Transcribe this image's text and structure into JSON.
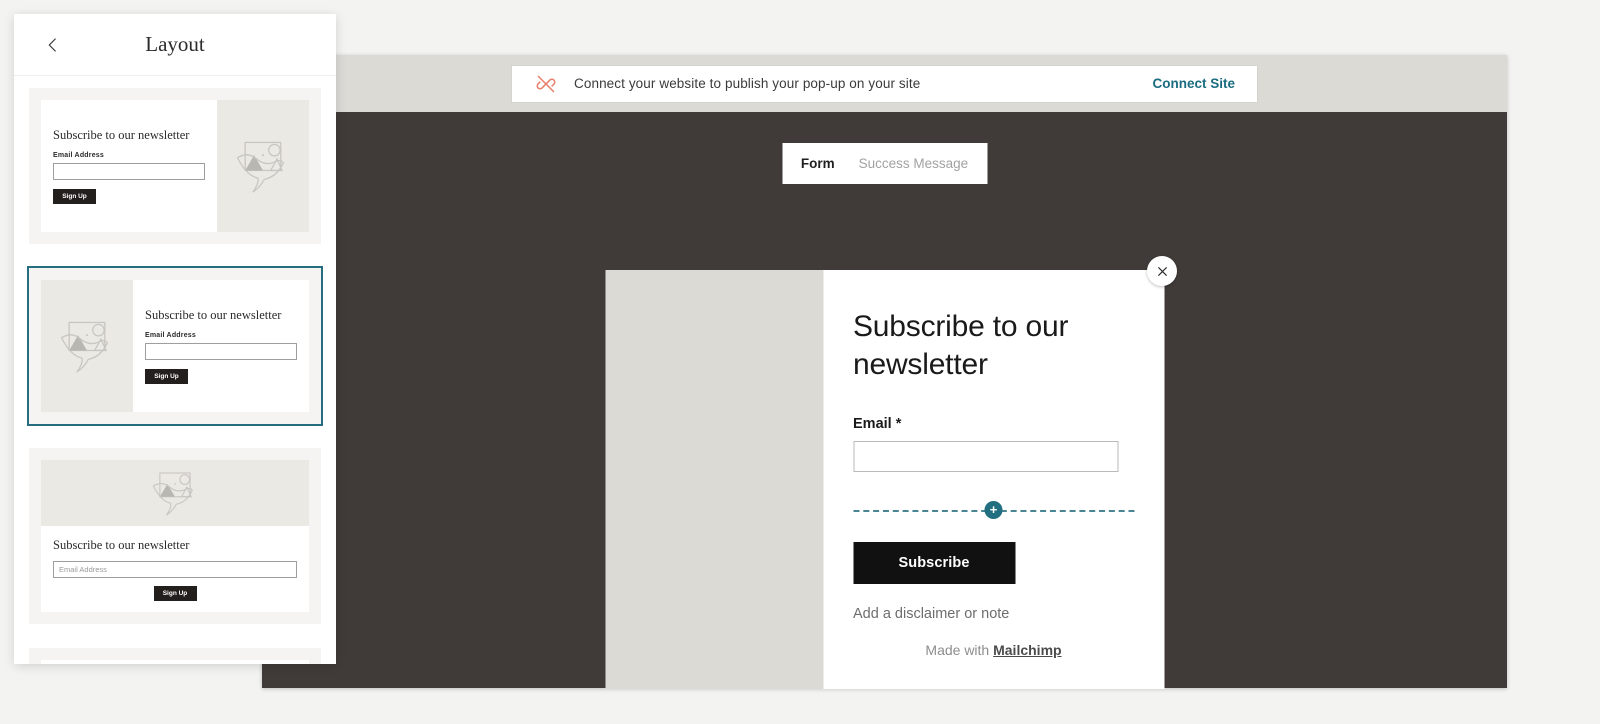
{
  "sidebar": {
    "back_icon": "chevron-left-icon",
    "title": "Layout",
    "layouts": [
      {
        "id": "image-right",
        "selected": false,
        "title": "Subscribe to our newsletter",
        "email_label": "Email Address",
        "email_placeholder": "",
        "button_label": "Sign Up",
        "image_icon": "bird-placeholder-icon"
      },
      {
        "id": "image-left",
        "selected": true,
        "title": "Subscribe to our newsletter",
        "email_label": "Email Address",
        "email_placeholder": "",
        "button_label": "Sign Up",
        "image_icon": "bird-placeholder-icon"
      },
      {
        "id": "image-top",
        "selected": false,
        "title": "Subscribe to our newsletter",
        "email_label": "",
        "email_placeholder": "Email Address",
        "button_label": "Sign Up",
        "image_icon": "bird-placeholder-icon"
      },
      {
        "id": "layout-four",
        "selected": false,
        "title": "",
        "email_label": "",
        "email_placeholder": "",
        "button_label": "",
        "image_icon": "bird-placeholder-icon"
      }
    ]
  },
  "banner": {
    "icon": "link-off-icon",
    "icon_color": "#e8806b",
    "message": "Connect your website to publish your pop-up on your site",
    "action_label": "Connect Site",
    "action_color": "#1b6c80"
  },
  "preview": {
    "tabs": [
      {
        "label": "Form",
        "active": true
      },
      {
        "label": "Success Message",
        "active": false
      }
    ],
    "close_icon": "close-icon",
    "popup": {
      "image_panel_color": "#dcdad5",
      "title": "Subscribe to our newsletter",
      "email_label": "Email *",
      "email_value": "",
      "add_block_icon": "plus-icon",
      "add_block_color": "#216f80",
      "submit_label": "Subscribe",
      "submit_color": "#111111",
      "disclaimer": "Add a disclaimer or note",
      "footer_prefix": "Made with",
      "footer_brand": "Mailchimp"
    }
  },
  "colors": {
    "page_background": "#f3f3f1",
    "preview_topbar": "#dcdad5",
    "preview_canvas": "#403b38",
    "accent_teal": "#266d80"
  }
}
